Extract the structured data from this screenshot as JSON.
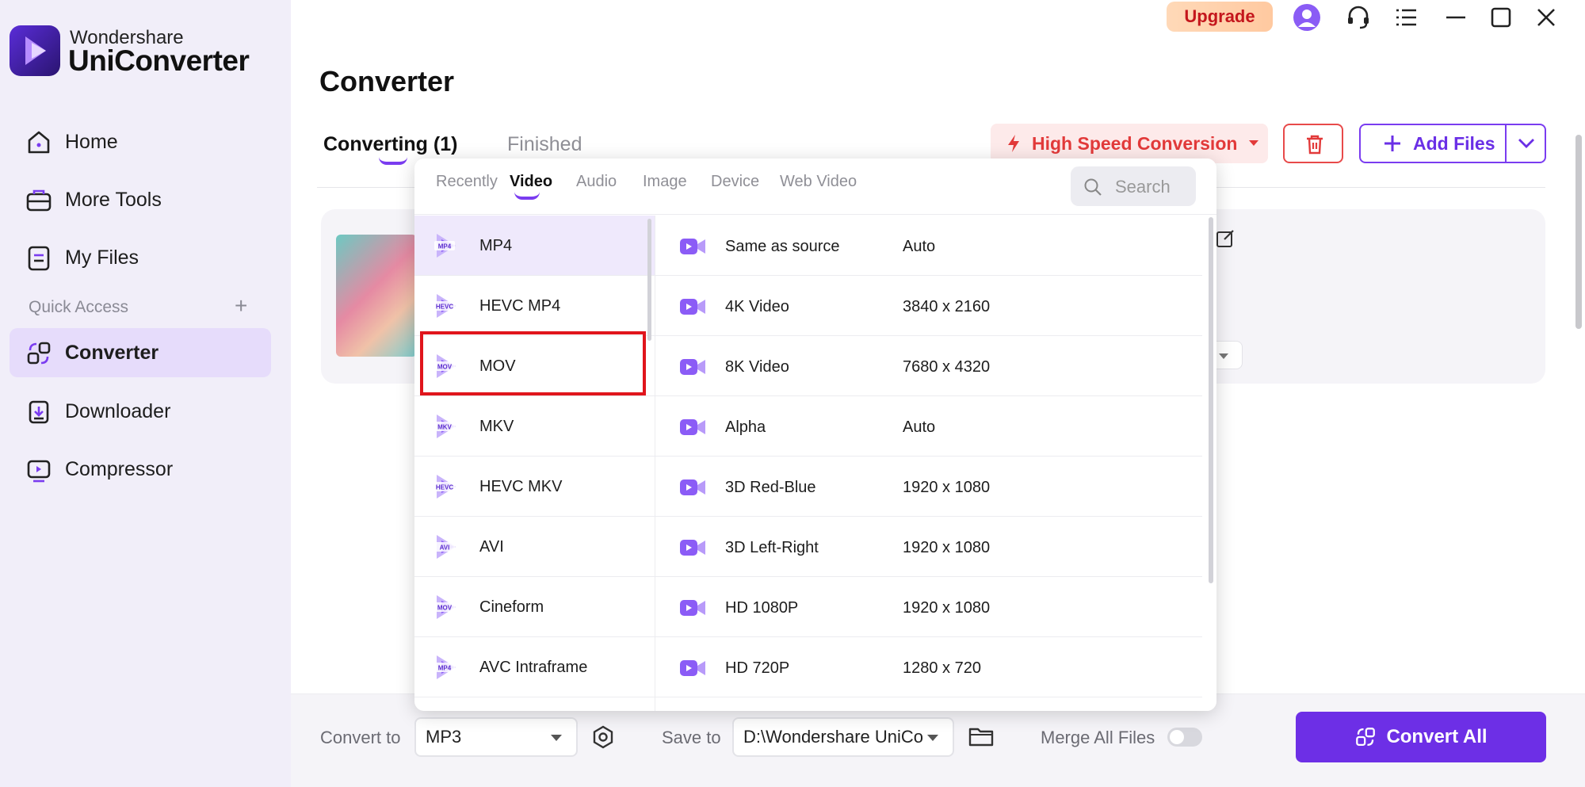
{
  "app": {
    "brand_top": "Wondershare",
    "brand_main": "UniConverter",
    "upgrade_label": "Upgrade",
    "accent_color": "#6d2fe6"
  },
  "sidebar": {
    "items": [
      {
        "label": "Home",
        "icon": "home-icon"
      },
      {
        "label": "More Tools",
        "icon": "toolbox-icon"
      },
      {
        "label": "My Files",
        "icon": "file-icon"
      }
    ],
    "quick_access_label": "Quick Access",
    "quick_items": [
      {
        "label": "Converter",
        "icon": "converter-icon",
        "active": true
      },
      {
        "label": "Downloader",
        "icon": "download-icon"
      },
      {
        "label": "Compressor",
        "icon": "compress-icon"
      }
    ]
  },
  "main": {
    "title": "Converter",
    "tabs": [
      {
        "label": "Converting (1)",
        "active": true
      },
      {
        "label": "Finished",
        "active": false
      }
    ],
    "high_speed_label": "High Speed Conversion",
    "add_files_label": "Add Files"
  },
  "popup": {
    "tabs": [
      "Recently",
      "Video",
      "Audio",
      "Image",
      "Device",
      "Web Video"
    ],
    "active_tab": "Video",
    "search_placeholder": "Search",
    "formats": [
      {
        "label": "MP4",
        "badge": "MP4",
        "selected": true
      },
      {
        "label": "HEVC MP4",
        "badge": "HEVC"
      },
      {
        "label": "MOV",
        "badge": "MOV",
        "highlighted": true
      },
      {
        "label": "MKV",
        "badge": "MKV"
      },
      {
        "label": "HEVC MKV",
        "badge": "HEVC"
      },
      {
        "label": "AVI",
        "badge": "AVI"
      },
      {
        "label": "Cineform",
        "badge": "MOV"
      },
      {
        "label": "AVC Intraframe",
        "badge": "MP4"
      }
    ],
    "resolutions": [
      {
        "name": "Same as source",
        "value": "Auto"
      },
      {
        "name": "4K Video",
        "value": "3840 x 2160"
      },
      {
        "name": "8K Video",
        "value": "7680 x 4320"
      },
      {
        "name": "Alpha",
        "value": "Auto"
      },
      {
        "name": "3D Red-Blue",
        "value": "1920 x 1080"
      },
      {
        "name": "3D Left-Right",
        "value": "1920 x 1080"
      },
      {
        "name": "HD 1080P",
        "value": "1920 x 1080"
      },
      {
        "name": "HD 720P",
        "value": "1280 x 720"
      }
    ]
  },
  "bottom": {
    "convert_to_label": "Convert to",
    "convert_to_value": "MP3",
    "save_to_label": "Save to",
    "save_to_value": "D:\\Wondershare UniCo",
    "merge_label": "Merge All Files",
    "merge_on": false,
    "convert_all_label": "Convert All"
  }
}
